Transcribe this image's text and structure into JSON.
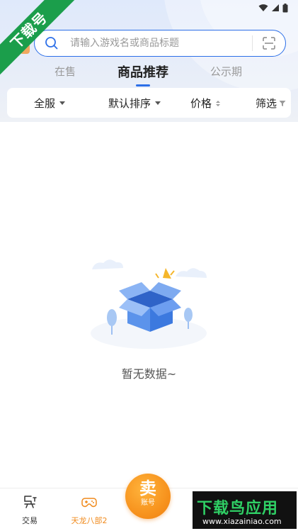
{
  "badge": {
    "text": "下载号"
  },
  "search": {
    "placeholder": "请输入游戏名或商品标题"
  },
  "tabs": [
    {
      "label": "在售"
    },
    {
      "label": "商品推荐"
    },
    {
      "label": "公示期"
    }
  ],
  "filters": [
    {
      "label": "全服"
    },
    {
      "label": "默认排序"
    },
    {
      "label": "价格"
    },
    {
      "label": "筛选"
    }
  ],
  "empty_state": {
    "message": "暂无数据~"
  },
  "bottom_nav": {
    "trade": {
      "label": "交易"
    },
    "game": {
      "label": "天龙八部2"
    },
    "sell": {
      "big": "卖",
      "small": "账号"
    }
  },
  "watermark": {
    "title": "下载鸟应用",
    "url": "www.xiazainiao.com"
  },
  "colors": {
    "accent": "#2c6fe8",
    "sell": "#f7931e",
    "badge": "#1b9e4b",
    "game_active": "#f08a1c"
  },
  "icons": [
    "wifi-icon",
    "signal-icon",
    "battery-icon",
    "search-icon",
    "scan-icon",
    "trade-icon",
    "gamepad-icon",
    "empty-box-icon"
  ]
}
